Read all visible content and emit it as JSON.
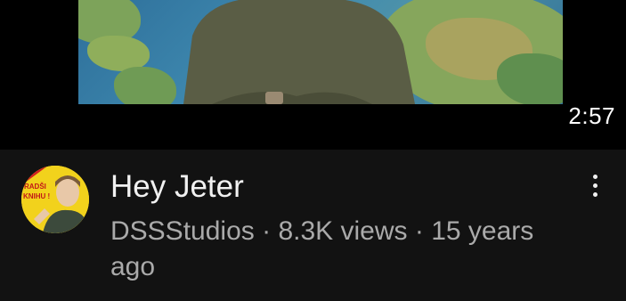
{
  "video": {
    "title": "Hey Jeter",
    "duration": "2:57",
    "channel": "DSSStudios",
    "views": "8.3K views",
    "age": "15 years ago",
    "separator": "·"
  },
  "avatar_text": {
    "line1": "RADŠI",
    "line2": "KNIHU !"
  },
  "icons": {
    "more": "more-vert-icon"
  }
}
